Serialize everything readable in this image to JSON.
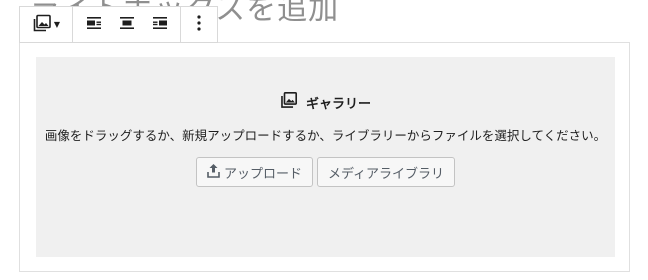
{
  "page": {
    "title": "ライトボックスを追加"
  },
  "toolbar": {
    "transform_icon": "gallery-icon",
    "dropdown_icon": "caret-down-icon",
    "align_left_icon": "align-left-icon",
    "align_center_icon": "align-center-icon",
    "align_right_icon": "align-right-icon",
    "more_icon": "more-vertical-icon"
  },
  "gallery_block": {
    "icon": "gallery-icon",
    "label": "ギャラリー",
    "instructions": "画像をドラッグするか、新規アップロードするか、ライブラリーからファイルを選択してください。",
    "upload_button": {
      "icon": "upload-icon",
      "label": "アップロード"
    },
    "media_library_button": {
      "label": "メディアライブラリ"
    }
  }
}
